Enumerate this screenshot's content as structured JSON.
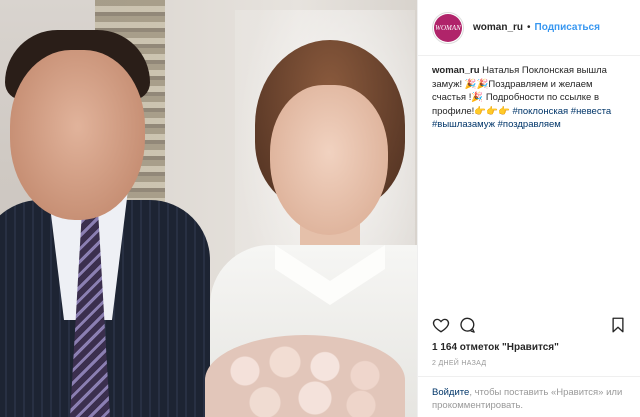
{
  "post": {
    "username": "woman_ru",
    "avatar_text": "WOMAN",
    "separator": "•",
    "follow_label": "Подписаться",
    "caption_user": "woman_ru",
    "caption_text": "Наталья Поклонская вышла замуж! 🎉🎉Поздравляем и желаем счастья !🎉 Подробности по ссылке в профиле!👉👉👉",
    "hashtags": [
      "#поклонская",
      "#невеста",
      "#вышлазамуж",
      "#поздравляем"
    ],
    "likes_text": "1 164 отметок \"Нравится\"",
    "time_text": "2 ДНЕЙ НАЗАД",
    "login_link": "Войдите",
    "login_text": ", чтобы поставить «Нравится» или прокомментировать."
  },
  "icons": [
    "heart-icon",
    "comment-icon",
    "bookmark-icon"
  ]
}
